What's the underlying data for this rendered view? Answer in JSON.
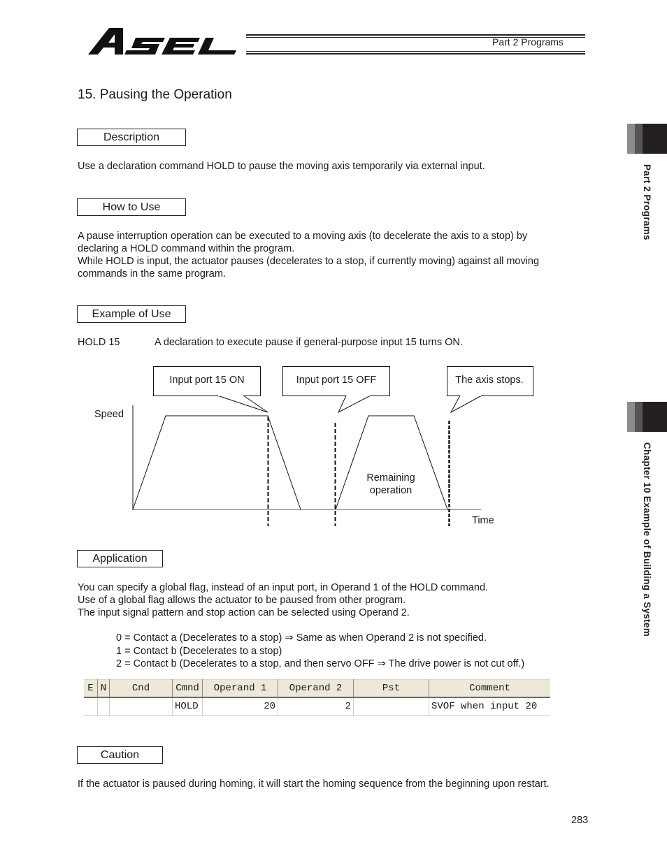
{
  "header": {
    "logo": "ASEL",
    "part_label": "Part 2  Programs"
  },
  "side_tabs": {
    "part": "Part 2  Programs",
    "chapter": "Chapter 10  Example of Building a System"
  },
  "page_title": "15. Pausing the Operation",
  "sections": {
    "description": {
      "heading": "Description",
      "lines": [
        "Use a declaration command HOLD to pause the moving axis temporarily via external input."
      ]
    },
    "how_to_use": {
      "heading": "How to Use",
      "lines": [
        "A pause interruption operation can be executed to a moving axis (to decelerate the axis to a stop) by",
        "declaring a HOLD command within the program.",
        "While HOLD is input, the actuator pauses (decelerates to a stop, if currently moving) against all moving",
        "commands in the same program."
      ]
    },
    "example": {
      "heading": "Example of Use",
      "command": "HOLD 15",
      "command_desc": "A declaration to execute pause if general-purpose input 15 turns ON."
    },
    "application": {
      "heading": "Application",
      "lines": [
        "You can specify a global flag, instead of an input port, in Operand 1 of the HOLD command.",
        "Use of a global flag allows the actuator to be paused from other program.",
        "The input signal pattern and stop action can be selected using Operand 2."
      ],
      "options": [
        "0 = Contact a (Decelerates to a stop) ⇒ Same as when Operand 2 is not specified.",
        "1 = Contact b (Decelerates to a stop)",
        "2 = Contact b (Decelerates to a stop, and then servo OFF ⇒ The drive power is not cut off.)"
      ]
    },
    "caution": {
      "heading": "Caution",
      "lines": [
        "If the actuator is paused during homing, it will start the homing sequence from the beginning upon restart."
      ]
    }
  },
  "diagram": {
    "y_label": "Speed",
    "x_label": "Time",
    "callouts": [
      "Input port 15 ON",
      "Input port 15 OFF",
      "The axis stops."
    ],
    "remaining_label": [
      "Remaining",
      "operation"
    ]
  },
  "program_table": {
    "columns": [
      "E",
      "N",
      "Cnd",
      "Cmnd",
      "Operand 1",
      "Operand 2",
      "Pst",
      "Comment"
    ],
    "rows": [
      [
        "",
        "",
        "",
        "HOLD",
        "20",
        "2",
        "",
        "SVOF when input 20"
      ]
    ]
  },
  "page_number": "283"
}
